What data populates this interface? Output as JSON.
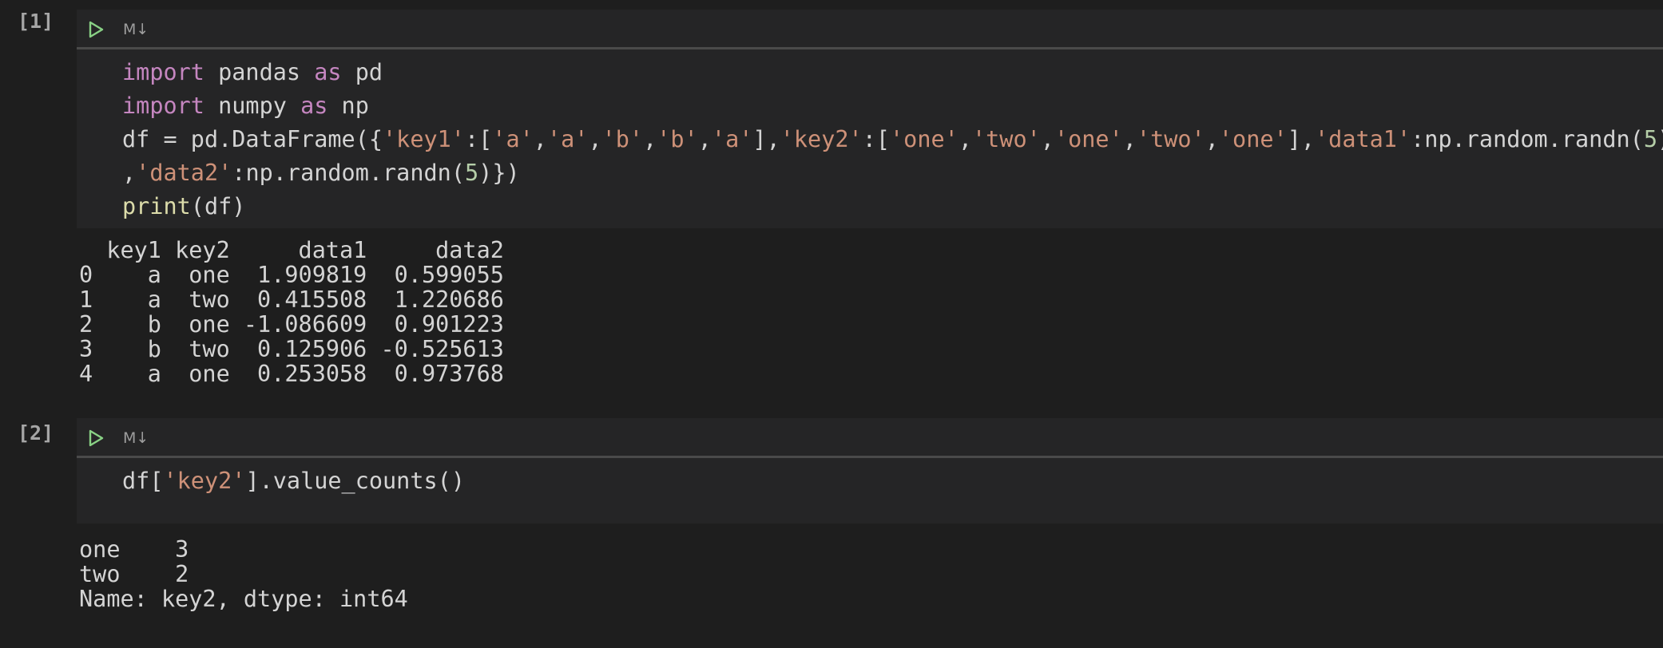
{
  "cells": [
    {
      "exec_count": "[1]",
      "md_label": "M↓",
      "code": [
        [
          [
            "kw",
            "import"
          ],
          [
            "plain",
            " pandas "
          ],
          [
            "kw",
            "as"
          ],
          [
            "plain",
            " pd"
          ]
        ],
        [
          [
            "kw",
            "import"
          ],
          [
            "plain",
            " numpy "
          ],
          [
            "kw",
            "as"
          ],
          [
            "plain",
            " np"
          ]
        ],
        [
          [
            "plain",
            "df = pd.DataFrame({"
          ],
          [
            "str",
            "'key1'"
          ],
          [
            "plain",
            ":["
          ],
          [
            "str",
            "'a'"
          ],
          [
            "plain",
            ","
          ],
          [
            "str",
            "'a'"
          ],
          [
            "plain",
            ","
          ],
          [
            "str",
            "'b'"
          ],
          [
            "plain",
            ","
          ],
          [
            "str",
            "'b'"
          ],
          [
            "plain",
            ","
          ],
          [
            "str",
            "'a'"
          ],
          [
            "plain",
            "],"
          ],
          [
            "str",
            "'key2'"
          ],
          [
            "plain",
            ":["
          ],
          [
            "str",
            "'one'"
          ],
          [
            "plain",
            ","
          ],
          [
            "str",
            "'two'"
          ],
          [
            "plain",
            ","
          ],
          [
            "str",
            "'one'"
          ],
          [
            "plain",
            ","
          ],
          [
            "str",
            "'two'"
          ],
          [
            "plain",
            ","
          ],
          [
            "str",
            "'one'"
          ],
          [
            "plain",
            "],"
          ],
          [
            "str",
            "'data1'"
          ],
          [
            "plain",
            ":np.random.randn("
          ],
          [
            "num",
            "5"
          ],
          [
            "plain",
            ")"
          ]
        ],
        [
          [
            "plain",
            ","
          ],
          [
            "str",
            "'data2'"
          ],
          [
            "plain",
            ":np.random.randn("
          ],
          [
            "num",
            "5"
          ],
          [
            "plain",
            ")})"
          ]
        ],
        [
          [
            "fn",
            "print"
          ],
          [
            "plain",
            "(df)"
          ]
        ]
      ],
      "output": [
        "  key1 key2     data1     data2",
        "0    a  one  1.909819  0.599055",
        "1    a  two  0.415508  1.220686",
        "2    b  one -1.086609  0.901223",
        "3    b  two  0.125906 -0.525613",
        "4    a  one  0.253058  0.973768"
      ]
    },
    {
      "exec_count": "[2]",
      "md_label": "M↓",
      "code": [
        [
          [
            "plain",
            "df["
          ],
          [
            "str",
            "'key2'"
          ],
          [
            "plain",
            "].value_counts()"
          ]
        ]
      ],
      "output": [
        "one    3",
        "two    2",
        "Name: key2, dtype: int64"
      ]
    }
  ],
  "colors": {
    "background": "#1e1e1e",
    "cell_background": "#252526",
    "keyword": "#c586c0",
    "string": "#ce9178",
    "number": "#b5cea8",
    "function": "#dcdcaa",
    "run_icon": "#89d185"
  },
  "icons": {
    "run": "play-triangle-icon"
  }
}
